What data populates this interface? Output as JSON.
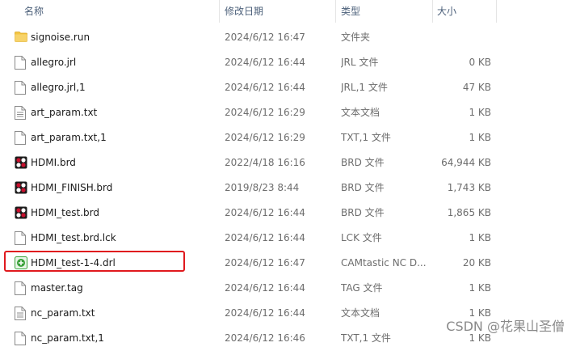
{
  "columns": {
    "name": "名称",
    "date": "修改日期",
    "type": "类型",
    "size": "大小"
  },
  "files": [
    {
      "name": "signoise.run",
      "date": "2024/6/12 16:47",
      "type": "文件夹",
      "size": "",
      "icon": "folder-icon"
    },
    {
      "name": "allegro.jrl",
      "date": "2024/6/12 16:44",
      "type": "JRL 文件",
      "size": "0 KB",
      "icon": "file-icon"
    },
    {
      "name": "allegro.jrl,1",
      "date": "2024/6/12 16:44",
      "type": "JRL,1 文件",
      "size": "47 KB",
      "icon": "file-icon"
    },
    {
      "name": "art_param.txt",
      "date": "2024/6/12 16:29",
      "type": "文本文档",
      "size": "1 KB",
      "icon": "text-file-icon"
    },
    {
      "name": "art_param.txt,1",
      "date": "2024/6/12 16:29",
      "type": "TXT,1 文件",
      "size": "1 KB",
      "icon": "file-icon"
    },
    {
      "name": "HDMI.brd",
      "date": "2022/4/18 16:16",
      "type": "BRD 文件",
      "size": "64,944 KB",
      "icon": "brd-file-icon"
    },
    {
      "name": "HDMI_FINISH.brd",
      "date": "2019/8/23 8:44",
      "type": "BRD 文件",
      "size": "1,743 KB",
      "icon": "brd-file-icon"
    },
    {
      "name": "HDMI_test.brd",
      "date": "2024/6/12 16:44",
      "type": "BRD 文件",
      "size": "1,865 KB",
      "icon": "brd-file-icon"
    },
    {
      "name": "HDMI_test.brd.lck",
      "date": "2024/6/12 16:44",
      "type": "LCK 文件",
      "size": "1 KB",
      "icon": "file-icon"
    },
    {
      "name": "HDMI_test-1-4.drl",
      "date": "2024/6/12 16:47",
      "type": "CAMtastic NC D...",
      "size": "20 KB",
      "icon": "drl-file-icon"
    },
    {
      "name": "master.tag",
      "date": "2024/6/12 16:44",
      "type": "TAG 文件",
      "size": "1 KB",
      "icon": "file-icon"
    },
    {
      "name": "nc_param.txt",
      "date": "2024/6/12 16:44",
      "type": "文本文档",
      "size": "1 KB",
      "icon": "text-file-icon"
    },
    {
      "name": "nc_param.txt,1",
      "date": "2024/6/12 16:46",
      "type": "TXT,1 文件",
      "size": "1 KB",
      "icon": "file-icon"
    }
  ],
  "watermark": "CSDN @花果山圣僧",
  "colors": {
    "highlight_border": "#e0191e",
    "header_text": "#4c607a",
    "folder": "#f4c542",
    "brd_icon": "#c8102e",
    "drl_icon": "#3aa13a"
  }
}
